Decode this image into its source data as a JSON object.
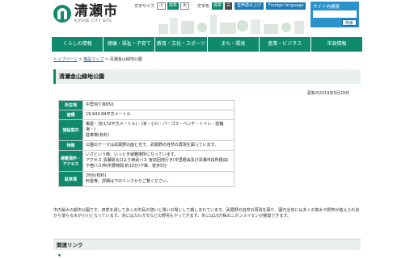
{
  "header": {
    "logo_jp": "清瀬市",
    "logo_en": "KIYOSE CITY SITE",
    "text_size_label": "文字サイズ",
    "text_size_small": "小",
    "text_size_standard": "標準",
    "text_size_large": "大",
    "text_color_label": "文字色",
    "text_color_standard": "標準",
    "text_color_white": "白",
    "util_links": [
      "音声読み上げ",
      "Foreign language"
    ],
    "search_title": "サイト内検索",
    "search_button": "検索",
    "search_placeholder": ""
  },
  "nav": [
    "くらしの情報",
    "健康・福祉・子育て",
    "教育・文化・スポーツ",
    "まち・環境",
    "産業・ビジネス",
    "市政情報"
  ],
  "breadcrumb": {
    "top": "トップページ",
    "facility": "施設マップ",
    "current": "清瀬金山緑地公園",
    "sep": ">"
  },
  "page_title": "清瀬金山緑地公園",
  "updated": "更新日2019年5月29日",
  "table": [
    {
      "label": "所在地",
      "value": "中里四丁目650"
    },
    {
      "label": "面積",
      "value": "19,943.84平方メートル"
    },
    {
      "label": "施設案内",
      "value": "東屋・池(172平方メートル)・(滝・小川・パーゴラ・ベンチ・トイレ・駐輪場・)\n駐車場(有料)"
    },
    {
      "label": "特徴",
      "value": "公園のテーマは武蔵野の面と光で、武蔵野の自然の再現を図っています。"
    },
    {
      "label": "避難場所・アクセス",
      "value": "いざという時、いっとき避難場所になっています。\nアクセス 清瀬駅北口より西武バス 宮前団地行き(中里経由及び清瀬市役所経由)下宿バス停(所要時間:約15分)下車、徒歩5分"
    },
    {
      "label": "駐車場",
      "value": "28台(有料)\n料金等、詳細は下のリンクからご覧ください。"
    }
  ],
  "description": "市内最大の都市公園です。四季を通して多くの市民の憩いと潤いの場として親しまれています。武蔵野の自然の再現を図り、園内全体には多くの樹木や野草が植えられ池から落ちる水が小川となっています。池にはカルガモなどの野鳥もやってきます。冬には10万株のニホンスイセンが観賞できます。",
  "related_links_heading": "関連リンク",
  "colors": {
    "brand": "#0f8a6c",
    "accent": "#2b93cc"
  }
}
